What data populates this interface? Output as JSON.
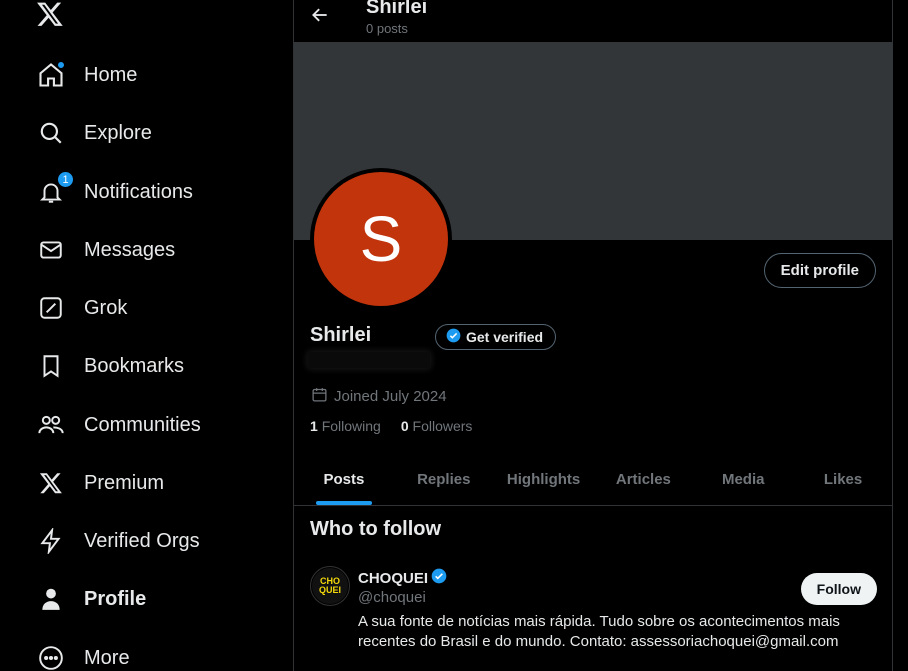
{
  "sidebar": {
    "items": [
      {
        "label": "Home",
        "icon": "home-icon"
      },
      {
        "label": "Explore",
        "icon": "search-icon"
      },
      {
        "label": "Notifications",
        "icon": "bell-icon",
        "badge": "1"
      },
      {
        "label": "Messages",
        "icon": "envelope-icon"
      },
      {
        "label": "Grok",
        "icon": "grok-icon"
      },
      {
        "label": "Bookmarks",
        "icon": "bookmark-icon"
      },
      {
        "label": "Communities",
        "icon": "people-icon"
      },
      {
        "label": "Premium",
        "icon": "x-logo-icon"
      },
      {
        "label": "Verified Orgs",
        "icon": "lightning-icon"
      },
      {
        "label": "Profile",
        "icon": "person-icon"
      },
      {
        "label": "More",
        "icon": "more-circle-icon"
      }
    ]
  },
  "header": {
    "name": "Shirlei",
    "posts_count": "0 posts"
  },
  "profile": {
    "avatar_letter": "S",
    "display_name": "Shirlei",
    "get_verified_label": "Get verified",
    "edit_profile_label": "Edit profile",
    "joined": "Joined July 2024",
    "following_count": "1",
    "following_label": "Following",
    "followers_count": "0",
    "followers_label": "Followers"
  },
  "tabs": [
    "Posts",
    "Replies",
    "Highlights",
    "Articles",
    "Media",
    "Likes"
  ],
  "who_to_follow": {
    "title": "Who to follow",
    "suggestion": {
      "name": "CHOQUEI",
      "handle": "@choquei",
      "bio": "A sua fonte de notícias mais rápida. Tudo sobre os acontecimentos mais recentes do Brasil e do mundo. Contato: assessoriachoquei@gmail.com",
      "avatar_text_top": "CHO",
      "avatar_text_bottom": "QUEI",
      "follow_label": "Follow"
    }
  },
  "colors": {
    "accent": "#1d9bf0",
    "avatar_bg": "#c1340c",
    "banner": "#333639"
  }
}
